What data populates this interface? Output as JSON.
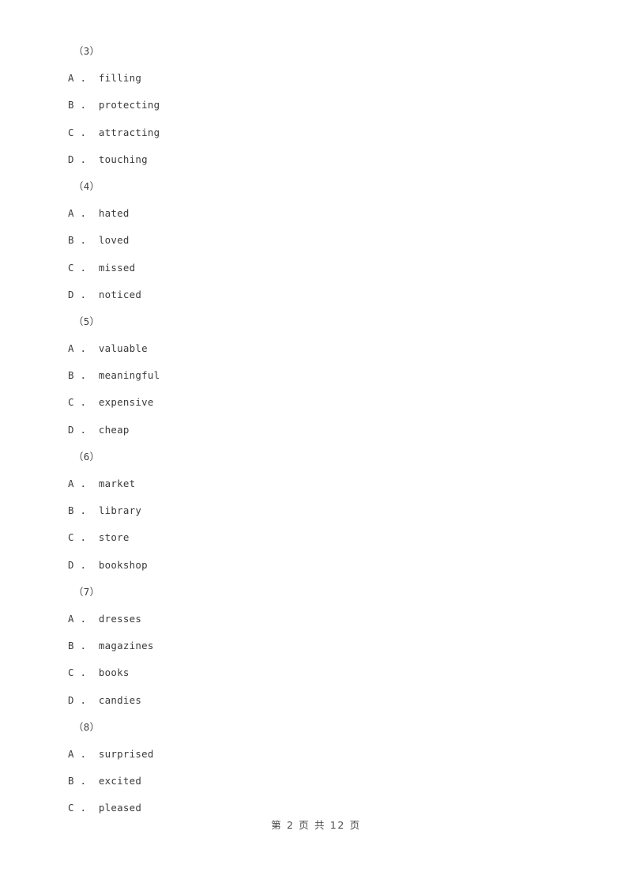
{
  "document": {
    "page_background": "#ffffff",
    "text_color": "#3a3a3a"
  },
  "questions": [
    {
      "number": "（3）",
      "options": [
        {
          "letter": "A",
          "separator": " .  ",
          "text": "filling"
        },
        {
          "letter": "B",
          "separator": " .  ",
          "text": "protecting"
        },
        {
          "letter": "C",
          "separator": " .  ",
          "text": "attracting"
        },
        {
          "letter": "D",
          "separator": " .  ",
          "text": "touching"
        }
      ]
    },
    {
      "number": "（4）",
      "options": [
        {
          "letter": "A",
          "separator": " .  ",
          "text": "hated"
        },
        {
          "letter": "B",
          "separator": " .  ",
          "text": "loved"
        },
        {
          "letter": "C",
          "separator": " .  ",
          "text": "missed"
        },
        {
          "letter": "D",
          "separator": " .  ",
          "text": "noticed"
        }
      ]
    },
    {
      "number": "（5）",
      "options": [
        {
          "letter": "A",
          "separator": " .  ",
          "text": "valuable"
        },
        {
          "letter": "B",
          "separator": " .  ",
          "text": "meaningful"
        },
        {
          "letter": "C",
          "separator": " .  ",
          "text": "expensive"
        },
        {
          "letter": "D",
          "separator": " .  ",
          "text": "cheap"
        }
      ]
    },
    {
      "number": "（6）",
      "options": [
        {
          "letter": "A",
          "separator": " .  ",
          "text": "market"
        },
        {
          "letter": "B",
          "separator": " .  ",
          "text": "library"
        },
        {
          "letter": "C",
          "separator": " .  ",
          "text": "store"
        },
        {
          "letter": "D",
          "separator": " .  ",
          "text": "bookshop"
        }
      ]
    },
    {
      "number": "（7）",
      "options": [
        {
          "letter": "A",
          "separator": " .  ",
          "text": "dresses"
        },
        {
          "letter": "B",
          "separator": " .  ",
          "text": "magazines"
        },
        {
          "letter": "C",
          "separator": " .  ",
          "text": "books"
        },
        {
          "letter": "D",
          "separator": " .  ",
          "text": "candies"
        }
      ]
    },
    {
      "number": "（8）",
      "options": [
        {
          "letter": "A",
          "separator": " .  ",
          "text": "surprised"
        },
        {
          "letter": "B",
          "separator": " .  ",
          "text": "excited"
        },
        {
          "letter": "C",
          "separator": " .  ",
          "text": "pleased"
        }
      ]
    }
  ],
  "footer": {
    "text": "第 2 页 共 12 页",
    "current_page": "2",
    "total_pages": "12"
  }
}
